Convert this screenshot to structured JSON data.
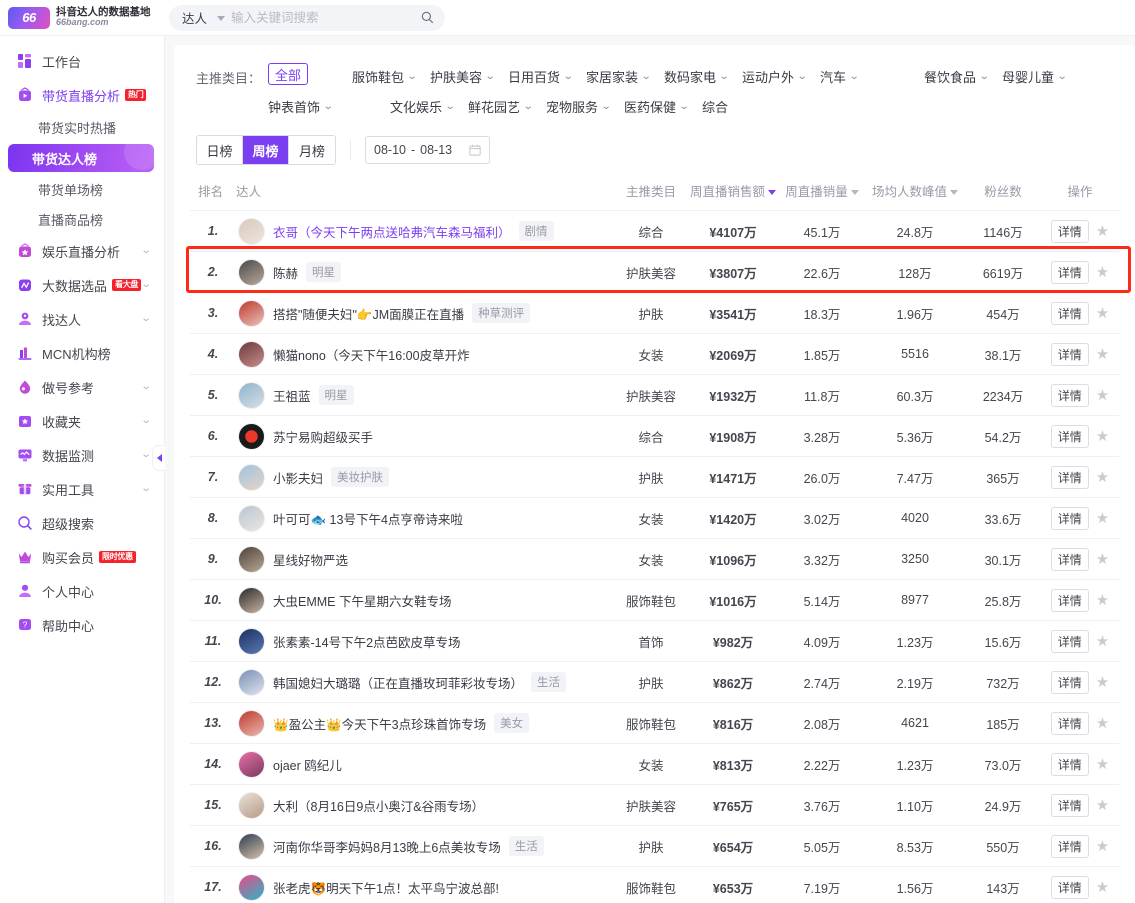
{
  "header": {
    "logo_mark": "66",
    "logo_title": "抖音达人的数据基地",
    "logo_domain": "66bang.com",
    "search_scope": "达人",
    "search_value": "",
    "search_placeholder": "输入关键词搜索",
    "search_icon": "search-icon"
  },
  "sidebar": {
    "items": [
      {
        "label": "工作台",
        "icon": "dashboard-icon",
        "expandable": false,
        "accent": false
      },
      {
        "label": "带货直播分析",
        "icon": "live-tv-icon",
        "expandable": false,
        "accent": true,
        "badge": "热门"
      },
      {
        "label": "娱乐直播分析",
        "icon": "entertainment-icon",
        "expandable": true,
        "accent": false
      },
      {
        "label": "大数据选品",
        "icon": "bigdata-icon",
        "expandable": true,
        "accent": false,
        "badge": "看大盘"
      },
      {
        "label": "找达人",
        "icon": "find-talent-icon",
        "expandable": true,
        "accent": false
      },
      {
        "label": "MCN机构榜",
        "icon": "mcn-icon",
        "expandable": false,
        "accent": false
      },
      {
        "label": "做号参考",
        "icon": "reference-icon",
        "expandable": true,
        "accent": false
      },
      {
        "label": "收藏夹",
        "icon": "favorites-icon",
        "expandable": true,
        "accent": false
      },
      {
        "label": "数据监测",
        "icon": "monitor-icon",
        "expandable": true,
        "accent": false
      },
      {
        "label": "实用工具",
        "icon": "tools-icon",
        "expandable": true,
        "accent": false
      },
      {
        "label": "超级搜索",
        "icon": "super-search-icon",
        "expandable": false,
        "accent": false
      },
      {
        "label": "购买会员",
        "icon": "crown-icon",
        "expandable": false,
        "accent": false,
        "badge": "限时优惠"
      },
      {
        "label": "个人中心",
        "icon": "user-icon",
        "expandable": false,
        "accent": false
      },
      {
        "label": "帮助中心",
        "icon": "help-icon",
        "expandable": false,
        "accent": false
      }
    ],
    "sub_items": [
      {
        "label": "带货实时热播",
        "active": false
      },
      {
        "label": "带货达人榜",
        "active": true
      },
      {
        "label": "带货单场榜",
        "active": false
      },
      {
        "label": "直播商品榜",
        "active": false
      }
    ],
    "collapse_icon": "collapse-sidebar-icon"
  },
  "filters": {
    "label": "主推类目：",
    "row1": [
      "全部",
      "服饰鞋包",
      "护肤美容",
      "日用百货",
      "家居家装",
      "数码家电",
      "运动户外",
      "汽车",
      "餐饮食品",
      "母婴儿童"
    ],
    "row2": [
      "钟表首饰",
      "文化娱乐",
      "鲜花园艺",
      "宠物服务",
      "医药保健",
      "综合"
    ],
    "selected": "全部"
  },
  "period": {
    "tabs": [
      {
        "label": "日榜",
        "active": false
      },
      {
        "label": "周榜",
        "active": true
      },
      {
        "label": "月榜",
        "active": false
      }
    ],
    "date_start": "08-10",
    "date_sep": "-",
    "date_end": "08-13",
    "calendar_icon": "calendar-icon"
  },
  "table": {
    "columns": [
      {
        "key": "rank",
        "label": "排名",
        "sortable": false,
        "sorted": false
      },
      {
        "key": "talent",
        "label": "达人",
        "sortable": false,
        "sorted": false
      },
      {
        "key": "category",
        "label": "主推类目",
        "sortable": false,
        "sorted": false
      },
      {
        "key": "sales_amount",
        "label": "周直播销售额",
        "sortable": true,
        "sorted": true
      },
      {
        "key": "sales_volume",
        "label": "周直播销量",
        "sortable": true,
        "sorted": false
      },
      {
        "key": "avg_peak",
        "label": "场均人数峰值",
        "sortable": true,
        "sorted": false
      },
      {
        "key": "fans",
        "label": "粉丝数",
        "sortable": false,
        "sorted": false
      },
      {
        "key": "ops",
        "label": "操作",
        "sortable": false,
        "sorted": false
      }
    ],
    "detail_label": "详情",
    "star_icon": "favorite-star-icon",
    "highlight_rank": "2",
    "highlight_color": "#ff2a16",
    "rows": [
      {
        "rank": "1.",
        "name": "衣哥（今天下午两点送哈弗汽车森马福利）",
        "name_purple": true,
        "tag": "剧情",
        "category": "综合",
        "sales_amount": "¥4107万",
        "sales_volume": "45.1万",
        "avg_peak": "24.8万",
        "fans": "1146万"
      },
      {
        "rank": "2.",
        "name": "陈赫",
        "name_purple": false,
        "tag": "明星",
        "category": "护肤美容",
        "sales_amount": "¥3807万",
        "sales_volume": "22.6万",
        "avg_peak": "128万",
        "fans": "6619万"
      },
      {
        "rank": "3.",
        "name": "搭搭\"随便夫妇\"👉JM面膜正在直播",
        "name_purple": false,
        "tag": "种草测评",
        "category": "护肤",
        "sales_amount": "¥3541万",
        "sales_volume": "18.3万",
        "avg_peak": "1.96万",
        "fans": "454万"
      },
      {
        "rank": "4.",
        "name": "懒猫nono（今天下午16:00皮草开炸",
        "name_purple": false,
        "tag": "",
        "category": "女装",
        "sales_amount": "¥2069万",
        "sales_volume": "1.85万",
        "avg_peak": "5516",
        "fans": "38.1万"
      },
      {
        "rank": "5.",
        "name": "王祖蓝",
        "name_purple": false,
        "tag": "明星",
        "category": "护肤美容",
        "sales_amount": "¥1932万",
        "sales_volume": "11.8万",
        "avg_peak": "60.3万",
        "fans": "2234万"
      },
      {
        "rank": "6.",
        "name": "苏宁易购超级买手",
        "name_purple": false,
        "tag": "",
        "category": "综合",
        "sales_amount": "¥1908万",
        "sales_volume": "3.28万",
        "avg_peak": "5.36万",
        "fans": "54.2万"
      },
      {
        "rank": "7.",
        "name": "小影夫妇",
        "name_purple": false,
        "tag": "美妆护肤",
        "category": "护肤",
        "sales_amount": "¥1471万",
        "sales_volume": "26.0万",
        "avg_peak": "7.47万",
        "fans": "365万"
      },
      {
        "rank": "8.",
        "name": "叶可可🐟 13号下午4点亨帝诗来啦",
        "name_purple": false,
        "tag": "",
        "category": "女装",
        "sales_amount": "¥1420万",
        "sales_volume": "3.02万",
        "avg_peak": "4020",
        "fans": "33.6万"
      },
      {
        "rank": "9.",
        "name": "星线好物严选",
        "name_purple": false,
        "tag": "",
        "category": "女装",
        "sales_amount": "¥1096万",
        "sales_volume": "3.32万",
        "avg_peak": "3250",
        "fans": "30.1万"
      },
      {
        "rank": "10.",
        "name": "大虫EMME 下午星期六女鞋专场",
        "name_purple": false,
        "tag": "",
        "category": "服饰鞋包",
        "sales_amount": "¥1016万",
        "sales_volume": "5.14万",
        "avg_peak": "8977",
        "fans": "25.8万"
      },
      {
        "rank": "11.",
        "name": "张素素-14号下午2点芭欧皮草专场",
        "name_purple": false,
        "tag": "",
        "category": "首饰",
        "sales_amount": "¥982万",
        "sales_volume": "4.09万",
        "avg_peak": "1.23万",
        "fans": "15.6万"
      },
      {
        "rank": "12.",
        "name": "韩国媳妇大璐璐（正在直播玫珂菲彩妆专场）",
        "name_purple": false,
        "tag": "生活",
        "category": "护肤",
        "sales_amount": "¥862万",
        "sales_volume": "2.74万",
        "avg_peak": "2.19万",
        "fans": "732万"
      },
      {
        "rank": "13.",
        "name": "👑盈公主👑今天下午3点珍珠首饰专场",
        "name_purple": false,
        "tag": "美女",
        "category": "服饰鞋包",
        "sales_amount": "¥816万",
        "sales_volume": "2.08万",
        "avg_peak": "4621",
        "fans": "185万"
      },
      {
        "rank": "14.",
        "name": "ojaer 鸥纪儿",
        "name_purple": false,
        "tag": "",
        "category": "女装",
        "sales_amount": "¥813万",
        "sales_volume": "2.22万",
        "avg_peak": "1.23万",
        "fans": "73.0万"
      },
      {
        "rank": "15.",
        "name": "大利（8月16日9点小奥汀&谷雨专场）",
        "name_purple": false,
        "tag": "",
        "category": "护肤美容",
        "sales_amount": "¥765万",
        "sales_volume": "3.76万",
        "avg_peak": "1.10万",
        "fans": "24.9万"
      },
      {
        "rank": "16.",
        "name": "河南你华哥李妈妈8月13晚上6点美妆专场",
        "name_purple": false,
        "tag": "生活",
        "category": "护肤",
        "sales_amount": "¥654万",
        "sales_volume": "5.05万",
        "avg_peak": "8.53万",
        "fans": "550万"
      },
      {
        "rank": "17.",
        "name": "张老虎🐯明天下午1点！太平鸟宁波总部!",
        "name_purple": false,
        "tag": "",
        "category": "服饰鞋包",
        "sales_amount": "¥653万",
        "sales_volume": "7.19万",
        "avg_peak": "1.56万",
        "fans": "143万"
      }
    ]
  },
  "colors": {
    "accent": "#7b3ff2",
    "highlight": "#ff2a16",
    "hot_badge": "#f5222d"
  }
}
